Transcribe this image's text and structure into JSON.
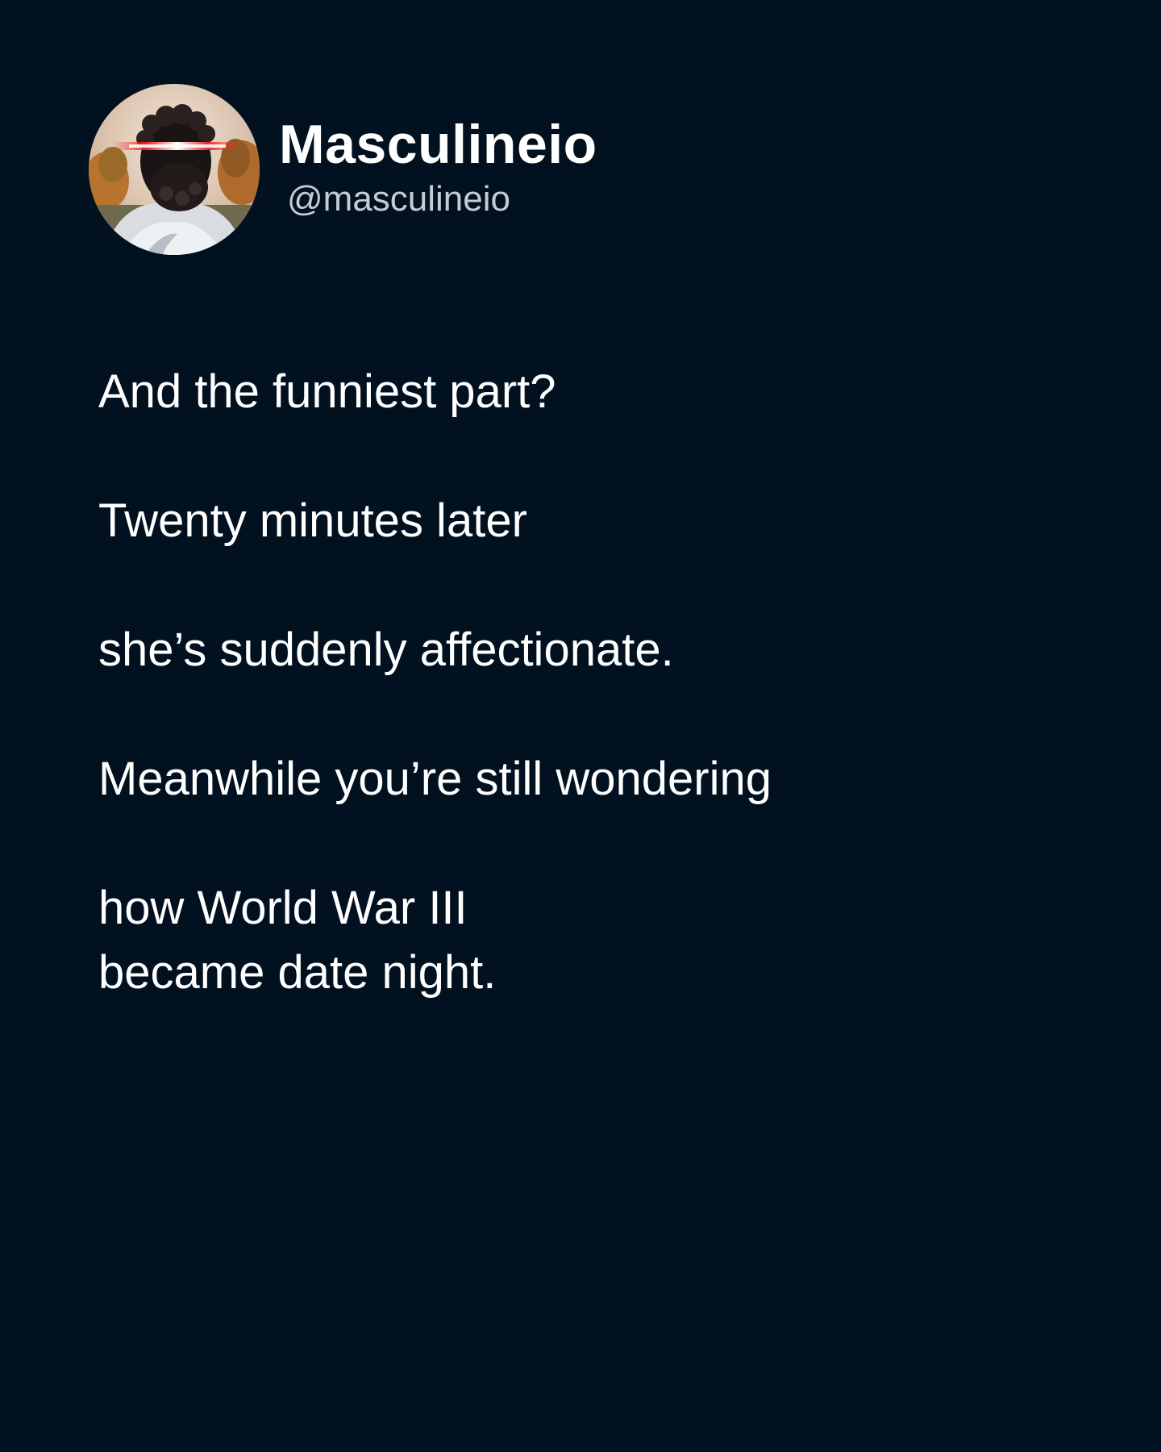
{
  "profile": {
    "display_name": "Masculineio",
    "handle": "@masculineio",
    "avatar_icon": "statue-avatar-icon"
  },
  "post": {
    "lines": [
      "And the funniest part?",
      "Twenty minutes later",
      "she’s suddenly affectionate.",
      "Meanwhile you’re still wondering",
      "how World War III",
      "became date night."
    ]
  },
  "colors": {
    "background": "#02111f",
    "text": "#ffffff",
    "handle": "#c6ccd4",
    "eye_glow": "#ff2a2a"
  }
}
